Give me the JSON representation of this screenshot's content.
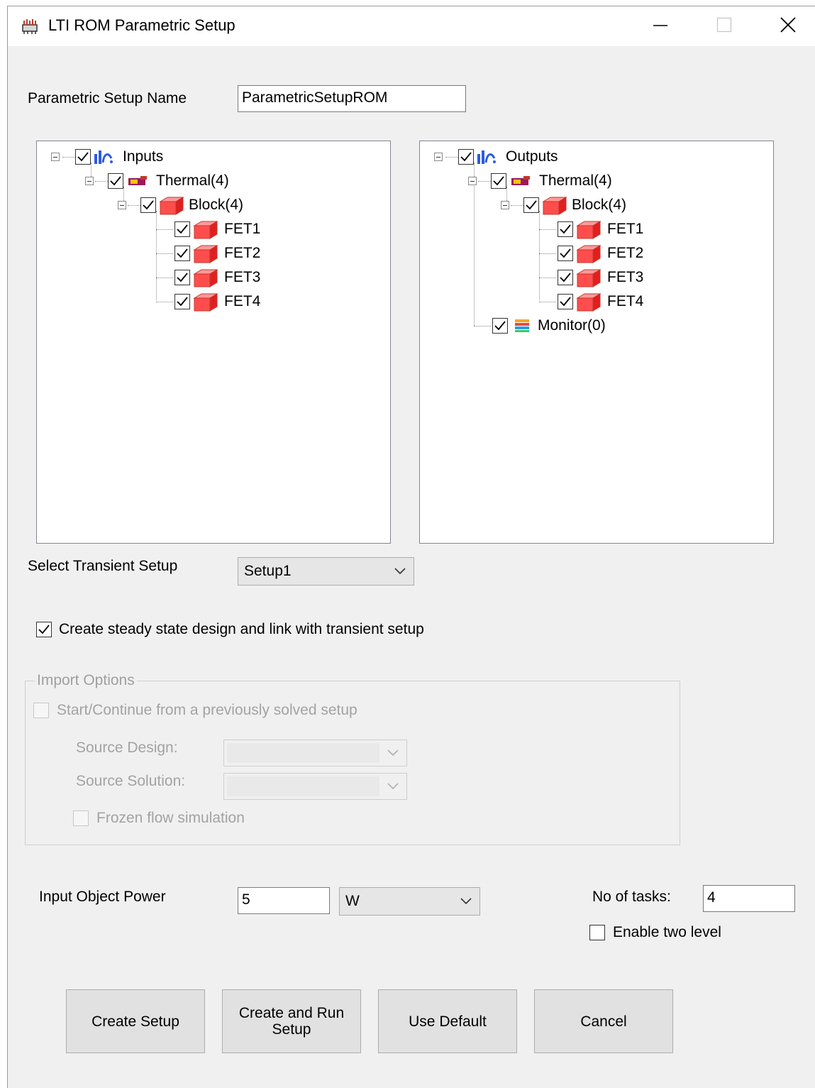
{
  "window": {
    "title": "LTI ROM Parametric Setup",
    "icons": {
      "app": "rom-setup-icon",
      "minimize": "minimize-icon",
      "maximize": "maximize-icon",
      "close": "close-icon"
    }
  },
  "setup_name": {
    "label": "Parametric Setup Name",
    "value": "ParametricSetupROM"
  },
  "inputs_tree": {
    "root": "Inputs",
    "thermal": "Thermal(4)",
    "block": "Block(4)",
    "items": [
      "FET1",
      "FET2",
      "FET3",
      "FET4"
    ]
  },
  "outputs_tree": {
    "root": "Outputs",
    "thermal": "Thermal(4)",
    "block": "Block(4)",
    "items": [
      "FET1",
      "FET2",
      "FET3",
      "FET4"
    ],
    "monitor": "Monitor(0)"
  },
  "transient": {
    "label": "Select Transient Setup",
    "value": "Setup1"
  },
  "steady_state": {
    "label": "Create steady state design and link with transient setup",
    "checked": true
  },
  "import_options": {
    "title": "Import Options",
    "start_continue": "Start/Continue from a previously solved setup",
    "source_design_label": "Source Design:",
    "source_solution_label": "Source Solution:",
    "frozen_flow": "Frozen flow simulation"
  },
  "power": {
    "label": "Input Object Power",
    "value": "5",
    "unit": "W"
  },
  "tasks": {
    "label": "No of tasks:",
    "value": "4",
    "two_level_label": "Enable two level"
  },
  "buttons": {
    "create_setup": "Create Setup",
    "create_run_line1": "Create and Run",
    "create_run_line2": "Setup",
    "use_default": "Use Default",
    "cancel": "Cancel"
  }
}
